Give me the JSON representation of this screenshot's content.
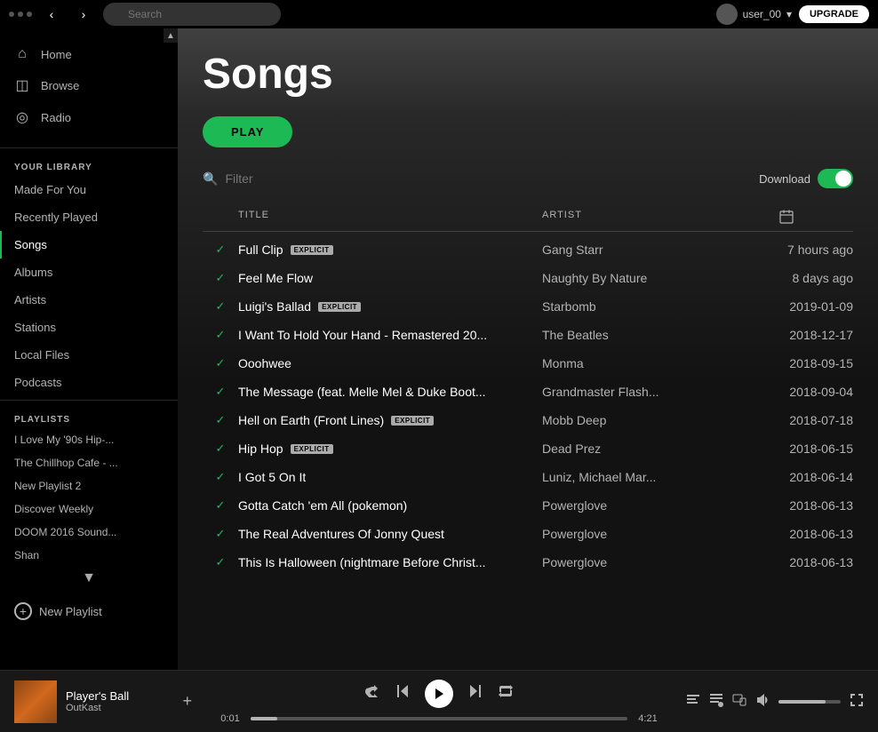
{
  "topbar": {
    "nav_back": "‹",
    "nav_fwd": "›",
    "search_placeholder": "Search",
    "username": "user_00",
    "upgrade_label": "UPGRADE"
  },
  "sidebar": {
    "scroll_up_icon": "▲",
    "nav_items": [
      {
        "id": "home",
        "label": "Home",
        "icon": "⌂",
        "active": false
      },
      {
        "id": "browse",
        "label": "Browse",
        "icon": "◫",
        "active": false
      },
      {
        "id": "radio",
        "label": "Radio",
        "icon": "◎",
        "active": false
      }
    ],
    "library_label": "YOUR LIBRARY",
    "library_items": [
      {
        "id": "made-for-you",
        "label": "Made For You",
        "active": false
      },
      {
        "id": "recently-played",
        "label": "Recently Played",
        "active": false
      },
      {
        "id": "songs",
        "label": "Songs",
        "active": true
      },
      {
        "id": "albums",
        "label": "Albums",
        "active": false
      },
      {
        "id": "artists",
        "label": "Artists",
        "active": false
      },
      {
        "id": "stations",
        "label": "Stations",
        "active": false
      },
      {
        "id": "local-files",
        "label": "Local Files",
        "active": false
      },
      {
        "id": "podcasts",
        "label": "Podcasts",
        "active": false
      }
    ],
    "playlists_label": "PLAYLISTS",
    "playlists": [
      {
        "id": "pl1",
        "label": "I Love My '90s Hip-..."
      },
      {
        "id": "pl2",
        "label": "The Chillhop Cafe - ..."
      },
      {
        "id": "pl3",
        "label": "New Playlist 2"
      },
      {
        "id": "pl4",
        "label": "Discover Weekly"
      },
      {
        "id": "pl5",
        "label": "DOOM 2016 Sound..."
      },
      {
        "id": "pl6",
        "label": "Shan"
      }
    ],
    "scroll_down_icon": "▼",
    "new_playlist_label": "New Playlist",
    "plus_icon": "+"
  },
  "content": {
    "page_title": "Songs",
    "play_button_label": "PLAY",
    "filter_placeholder": "Filter",
    "download_label": "Download",
    "table_headers": {
      "title": "TITLE",
      "artist": "ARTIST",
      "date_icon": "📅"
    },
    "songs": [
      {
        "id": 1,
        "title": "Full Clip",
        "explicit": true,
        "artist": "Gang Starr",
        "date": "7 hours ago"
      },
      {
        "id": 2,
        "title": "Feel Me Flow",
        "explicit": false,
        "artist": "Naughty By Nature",
        "date": "8 days ago"
      },
      {
        "id": 3,
        "title": "Luigi's Ballad",
        "explicit": true,
        "artist": "Starbomb",
        "date": "2019-01-09"
      },
      {
        "id": 4,
        "title": "I Want To Hold Your Hand - Remastered 20...",
        "explicit": false,
        "artist": "The Beatles",
        "date": "2018-12-17"
      },
      {
        "id": 5,
        "title": "Ooohwee",
        "explicit": false,
        "artist": "Monma",
        "date": "2018-09-15"
      },
      {
        "id": 6,
        "title": "The Message (feat. Melle Mel & Duke Boot...",
        "explicit": false,
        "artist": "Grandmaster Flash...",
        "date": "2018-09-04"
      },
      {
        "id": 7,
        "title": "Hell on Earth (Front Lines)",
        "explicit": true,
        "artist": "Mobb Deep",
        "date": "2018-07-18"
      },
      {
        "id": 8,
        "title": "Hip Hop",
        "explicit": true,
        "artist": "Dead Prez",
        "date": "2018-06-15"
      },
      {
        "id": 9,
        "title": "I Got 5 On It",
        "explicit": false,
        "artist": "Luniz, Michael Mar...",
        "date": "2018-06-14"
      },
      {
        "id": 10,
        "title": "Gotta Catch 'em All (pokemon)",
        "explicit": false,
        "artist": "Powerglove",
        "date": "2018-06-13"
      },
      {
        "id": 11,
        "title": "The Real Adventures Of Jonny Quest",
        "explicit": false,
        "artist": "Powerglove",
        "date": "2018-06-13"
      },
      {
        "id": 12,
        "title": "This Is Halloween (nightmare Before Christ...",
        "explicit": false,
        "artist": "Powerglove",
        "date": "2018-06-13"
      }
    ]
  },
  "player": {
    "track_name": "Player's Ball",
    "track_artist": "OutKast",
    "add_icon": "+",
    "shuffle_icon": "⇄",
    "prev_icon": "⏮",
    "play_icon": "▶",
    "next_icon": "⏭",
    "repeat_icon": "↻",
    "time_current": "0:01",
    "time_total": "4:21",
    "progress_percent": 7,
    "lyrics_icon": "≡",
    "queue_icon": "☰",
    "devices_icon": "💻",
    "volume_icon": "🔊",
    "fullscreen_icon": "⤢",
    "volume_percent": 75
  },
  "colors": {
    "accent_green": "#1db954",
    "bg_dark": "#121212",
    "bg_sidebar": "#000000",
    "bg_content": "#282828",
    "text_primary": "#ffffff",
    "text_secondary": "#b3b3b3"
  }
}
